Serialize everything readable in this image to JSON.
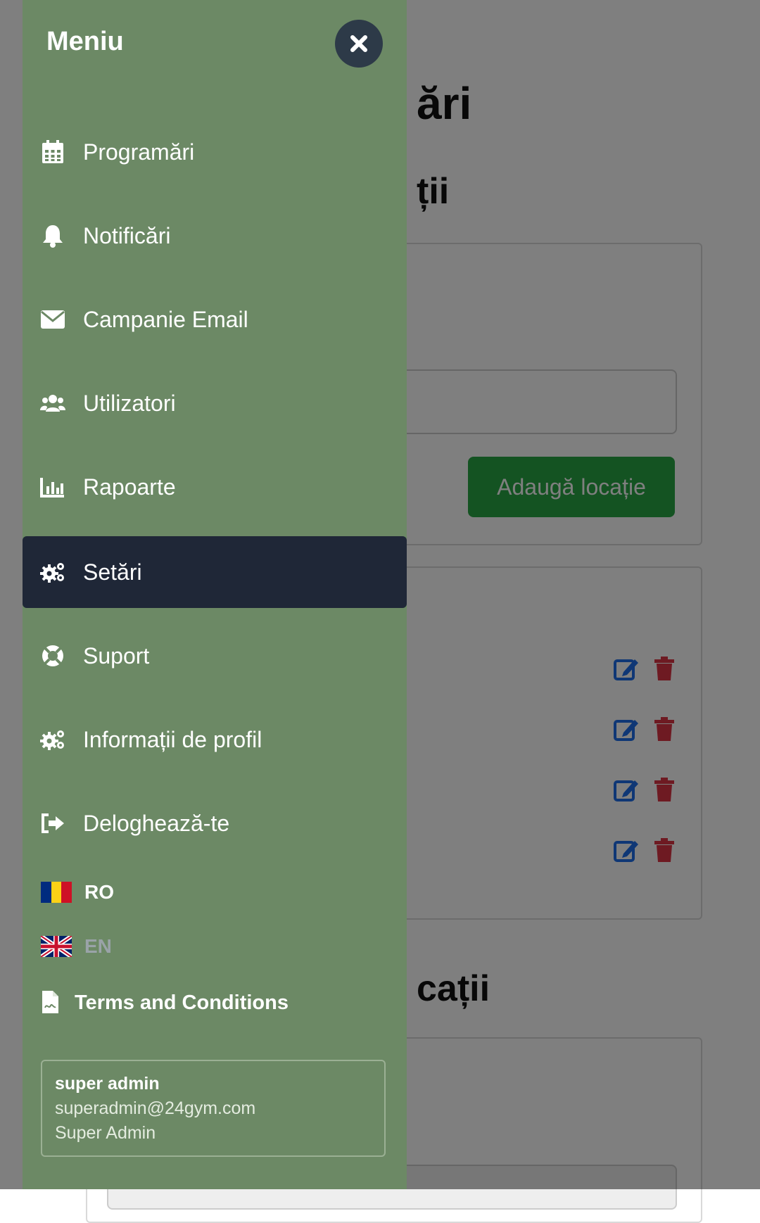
{
  "background": {
    "title_fragment": "ări",
    "subtitle_fragment": "ții",
    "subtitle2_fragment": "cații",
    "add_button_label": "Adaugă locație",
    "rows_count_label": ""
  },
  "sidebar": {
    "title": "Meniu",
    "items": [
      {
        "label": "Programări",
        "icon": "calendar-icon"
      },
      {
        "label": "Notificări",
        "icon": "bell-icon"
      },
      {
        "label": "Campanie Email",
        "icon": "envelope-icon"
      },
      {
        "label": "Utilizatori",
        "icon": "users-icon"
      },
      {
        "label": "Rapoarte",
        "icon": "chart-icon"
      },
      {
        "label": "Setări",
        "icon": "gears-icon",
        "active": true
      },
      {
        "label": "Suport",
        "icon": "life-ring-icon"
      },
      {
        "label": "Informații de profil",
        "icon": "gears-icon"
      },
      {
        "label": "Deloghează-te",
        "icon": "sign-out-icon"
      }
    ],
    "languages": [
      {
        "code": "RO",
        "active": true
      },
      {
        "code": "EN",
        "active": false
      }
    ],
    "terms_label": "Terms and Conditions",
    "profile": {
      "name": "super admin",
      "email": "superadmin@24gym.com",
      "role": "Super Admin"
    }
  },
  "colors": {
    "sidebar_bg": "#6c8965",
    "active_item_bg": "#1f2737",
    "close_button_bg": "#2d3a48",
    "add_button_bg": "#28a745",
    "edit_icon": "#1f6feb",
    "delete_icon": "#dc3545",
    "inactive_language_text": "#9aa3a8"
  }
}
